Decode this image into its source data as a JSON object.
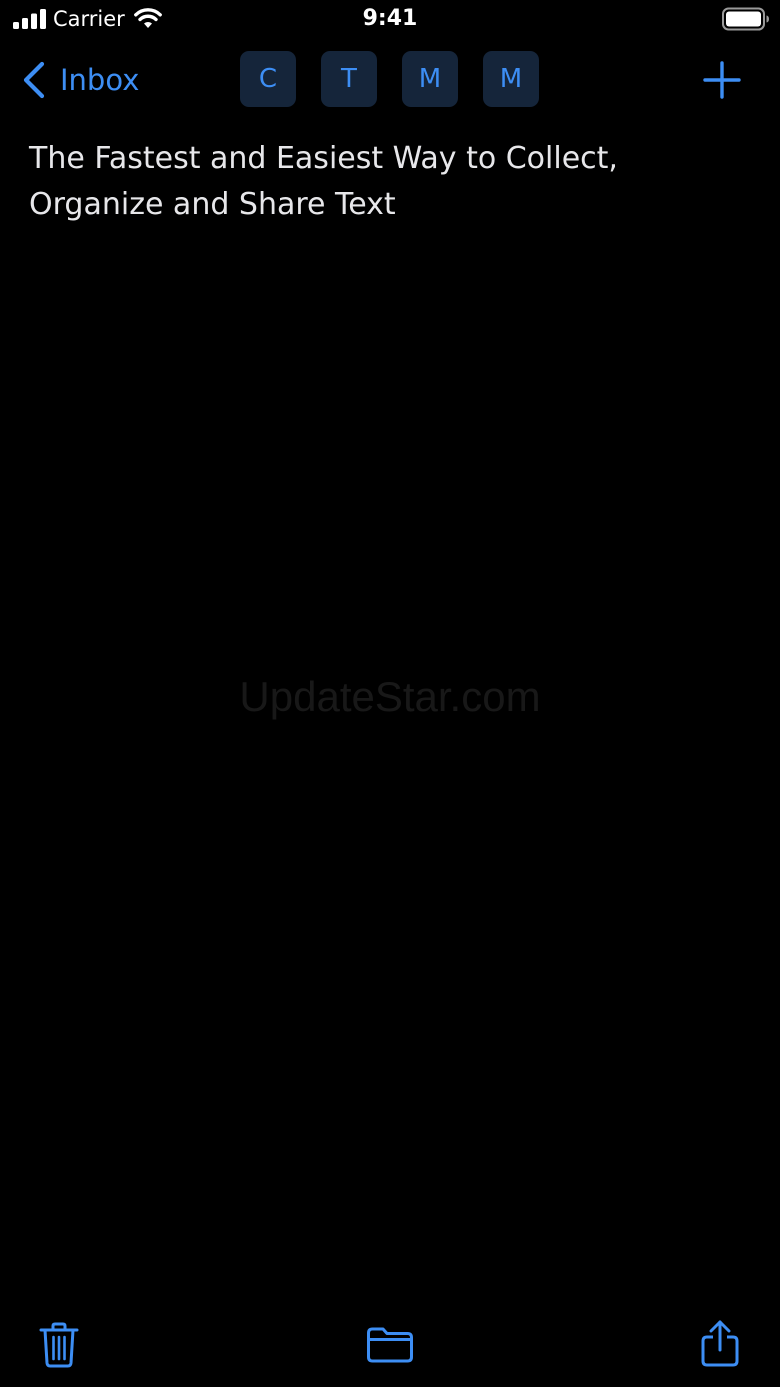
{
  "status_bar": {
    "carrier": "Carrier",
    "time": "9:41"
  },
  "nav": {
    "back_label": "Inbox",
    "tags": [
      "C",
      "T",
      "M",
      "M"
    ]
  },
  "note": {
    "text": "The Fastest and Easiest Way to Collect,\nOrganize and Share Text"
  },
  "watermark": "UpdateStar.com",
  "colors": {
    "accent": "#3d8ef4",
    "background": "#000000",
    "tag_background": "#15253a"
  },
  "icons": {
    "back": "chevron-left-icon",
    "add": "plus-icon",
    "trash": "trash-icon",
    "folder": "folder-icon",
    "share": "share-icon"
  }
}
